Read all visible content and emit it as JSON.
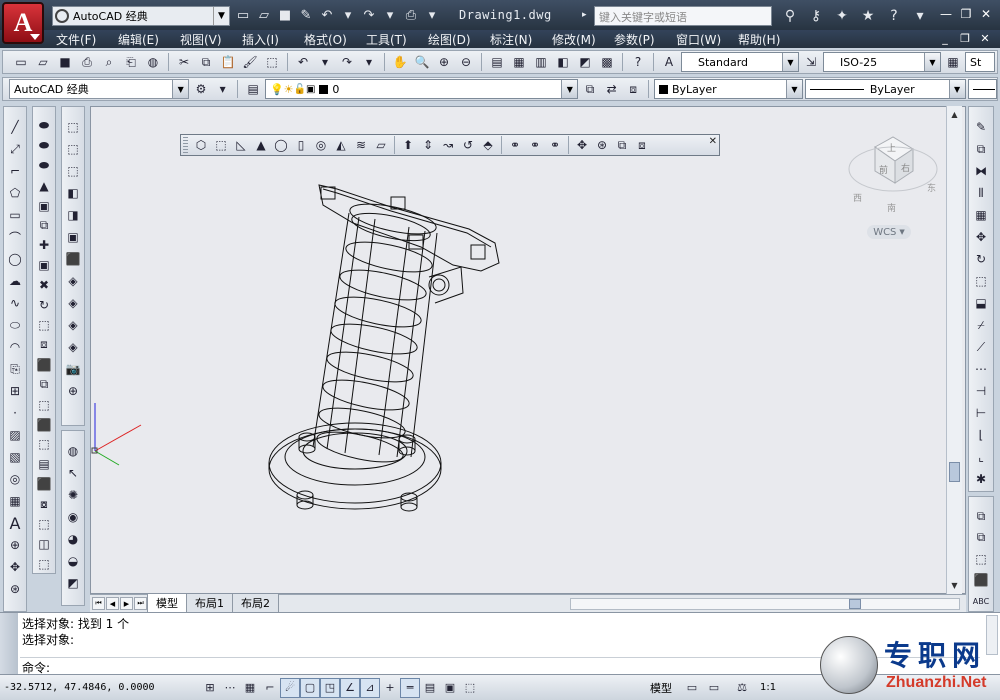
{
  "app": {
    "logo_letter": "A",
    "workspace": "AutoCAD 经典",
    "document_title": "Drawing1.dwg",
    "search_placeholder": "键入关键字或短语"
  },
  "menubar": {
    "items": [
      {
        "label": "文件(F)"
      },
      {
        "label": "编辑(E)"
      },
      {
        "label": "视图(V)"
      },
      {
        "label": "插入(I)"
      },
      {
        "label": "格式(O)"
      },
      {
        "label": "工具(T)"
      },
      {
        "label": "绘图(D)"
      },
      {
        "label": "标注(N)"
      },
      {
        "label": "修改(M)"
      },
      {
        "label": "参数(P)"
      },
      {
        "label": "窗口(W)"
      },
      {
        "label": "帮助(H)"
      }
    ]
  },
  "toolbar": {
    "text_style": "Standard",
    "dim_style": "ISO-25",
    "table_style_partial": "St",
    "workspace_combo": "AutoCAD 经典",
    "layer_name": "0",
    "color": "ByLayer",
    "linetype": "ByLayer"
  },
  "viewcube": {
    "top_label": "上",
    "front_label": "前",
    "right_label": "右",
    "compass_s": "南",
    "compass_w": "西",
    "compass_e": "东",
    "ucs_label": "WCS"
  },
  "layout_tabs": [
    {
      "label": "模型",
      "active": true
    },
    {
      "label": "布局1",
      "active": false
    },
    {
      "label": "布局2",
      "active": false
    }
  ],
  "command": {
    "history": [
      "选择对象: 找到 1 个",
      "选择对象:"
    ],
    "prompt": "命令:"
  },
  "status": {
    "coordinates": "-32.5712, 47.4846, 0.0000",
    "model_label": "模型",
    "scale": "1:1"
  },
  "watermark": {
    "cn": "专职网",
    "en": "Zhuanzhi.Net"
  }
}
